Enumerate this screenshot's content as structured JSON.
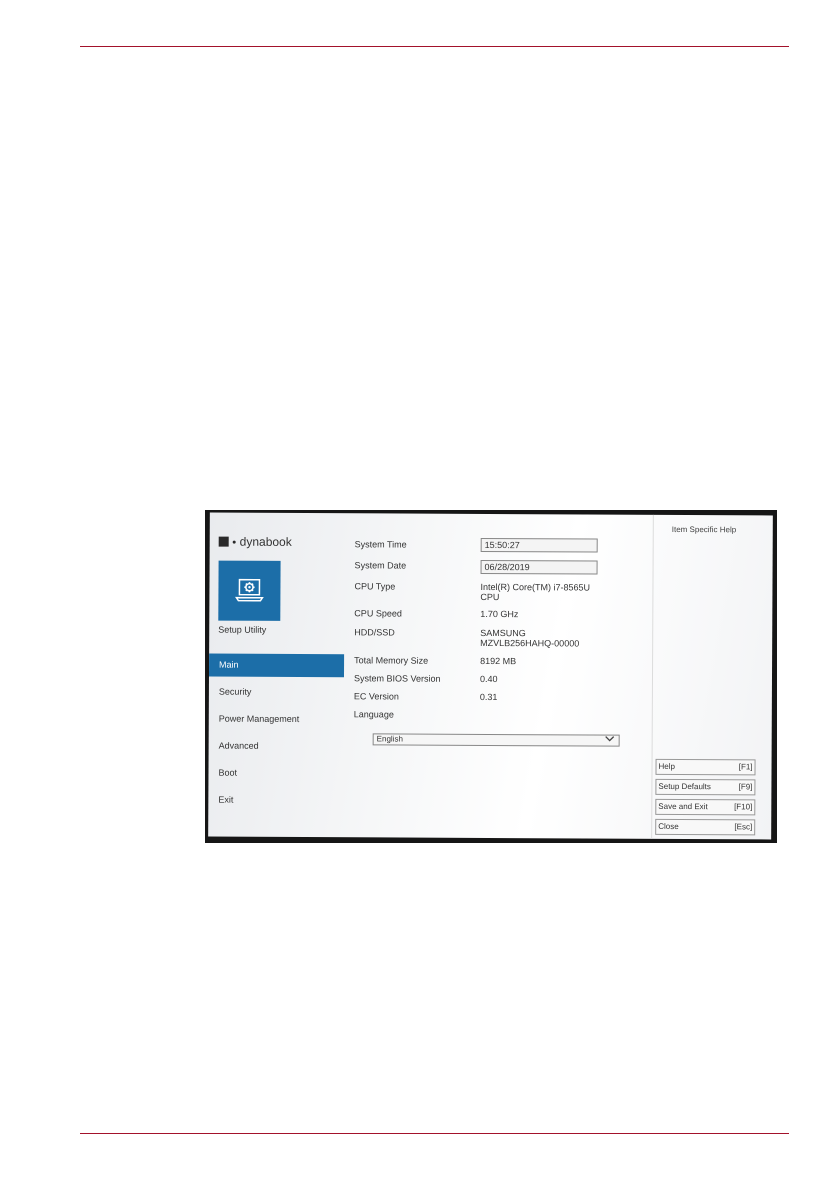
{
  "brand": {
    "name": "dynabook",
    "icon": "dynabook-logo-icon"
  },
  "tile": {
    "icon": "laptop-gear-icon",
    "color": "#1c6ea8"
  },
  "sidebar": {
    "title": "Setup Utility",
    "items": [
      {
        "label": "Main",
        "active": true
      },
      {
        "label": "Security",
        "active": false
      },
      {
        "label": "Power Management",
        "active": false
      },
      {
        "label": "Advanced",
        "active": false
      },
      {
        "label": "Boot",
        "active": false
      },
      {
        "label": "Exit",
        "active": false
      }
    ]
  },
  "main": {
    "system_time": {
      "label": "System Time",
      "value": "15:50:27"
    },
    "system_date": {
      "label": "System Date",
      "value": "06/28/2019"
    },
    "cpu_type": {
      "label": "CPU Type",
      "value_line1": "Intel(R) Core(TM) i7-8565U",
      "value_line2": "CPU"
    },
    "cpu_speed": {
      "label": "CPU Speed",
      "value": "1.70 GHz"
    },
    "hdd_ssd": {
      "label": "HDD/SSD",
      "value_line1": "SAMSUNG",
      "value_line2": "MZVLB256HAHQ-00000"
    },
    "total_memory": {
      "label": "Total Memory Size",
      "value": "8192 MB"
    },
    "bios_version": {
      "label": "System BIOS Version",
      "value": "0.40"
    },
    "ec_version": {
      "label": "EC Version",
      "value": "0.31"
    },
    "language": {
      "label": "Language",
      "selected": "English"
    }
  },
  "help": {
    "title": "Item Specific Help",
    "keys": [
      {
        "label": "Help",
        "key": "[F1]"
      },
      {
        "label": "Setup Defaults",
        "key": "[F9]"
      },
      {
        "label": "Save and Exit",
        "key": "[F10]"
      },
      {
        "label": "Close",
        "key": "[Esc]"
      }
    ]
  },
  "colors": {
    "accent": "#1c6ea8",
    "rule": "#a3122b"
  }
}
